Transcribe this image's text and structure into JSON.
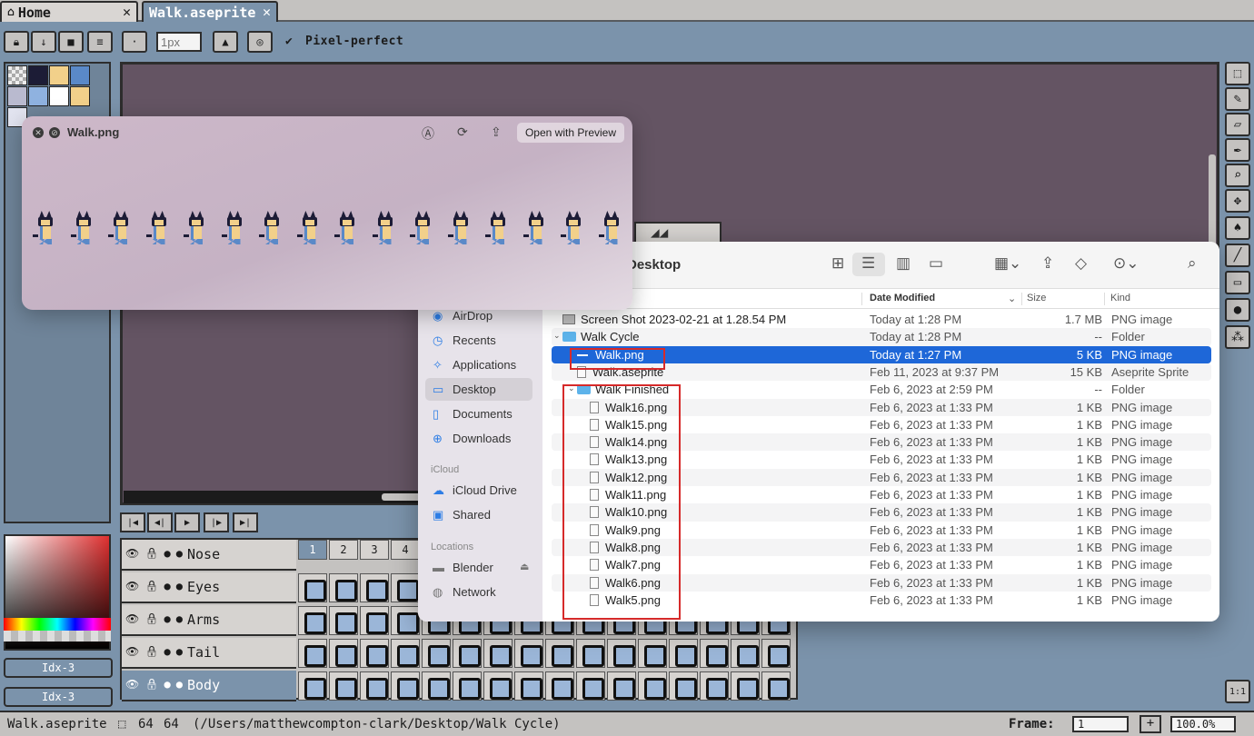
{
  "aseprite": {
    "tabs": [
      {
        "label": "Home",
        "close": "✕"
      },
      {
        "label": "Walk.aseprite",
        "close": "✕"
      }
    ],
    "toolbar": {
      "brush_size_placeholder": "1px",
      "pixel_perfect_label": "Pixel-perfect"
    },
    "layers": [
      {
        "name": "Nose"
      },
      {
        "name": "Eyes"
      },
      {
        "name": "Arms"
      },
      {
        "name": "Tail"
      },
      {
        "name": "Body"
      }
    ],
    "frame_numbers": [
      "1",
      "2",
      "3",
      "4"
    ],
    "idx_buttons": [
      "Idx-3",
      "Idx-3"
    ],
    "status": {
      "filename": "Walk.aseprite",
      "size_w": "64",
      "size_h": "64",
      "path": "(/Users/matthewcompton-clark/Desktop/Walk Cycle)",
      "frame_label": "Frame:",
      "frame_value": "1",
      "plus": "+",
      "zoom": "100.0%"
    }
  },
  "quicklook": {
    "title": "Walk.png",
    "open_button": "Open with Preview"
  },
  "finder": {
    "title": "Desktop",
    "columns": {
      "date": "Date Modified",
      "size": "Size",
      "kind": "Kind"
    },
    "sidebar": {
      "favorites": [
        {
          "label": "AirDrop",
          "icon": "airdrop-icon"
        },
        {
          "label": "Recents",
          "icon": "clock-icon"
        },
        {
          "label": "Applications",
          "icon": "applications-icon"
        },
        {
          "label": "Desktop",
          "icon": "desktop-icon"
        },
        {
          "label": "Documents",
          "icon": "document-icon"
        },
        {
          "label": "Downloads",
          "icon": "download-icon"
        }
      ],
      "icloud_header": "iCloud",
      "icloud": [
        {
          "label": "iCloud Drive",
          "icon": "cloud-icon"
        },
        {
          "label": "Shared",
          "icon": "shared-folder-icon"
        }
      ],
      "locations_header": "Locations",
      "locations": [
        {
          "label": "Blender",
          "icon": "disk-icon"
        },
        {
          "label": "Network",
          "icon": "globe-icon"
        }
      ]
    },
    "rows": [
      {
        "name": "Screen Shot 2023-02-21 at 1.28.54 PM",
        "date": "Today at 1:28 PM",
        "size": "1.7 MB",
        "kind": "PNG image"
      },
      {
        "name": "Walk Cycle",
        "date": "Today at 1:28 PM",
        "size": "--",
        "kind": "Folder"
      },
      {
        "name": "Walk.png",
        "date": "Today at 1:27 PM",
        "size": "5 KB",
        "kind": "PNG image"
      },
      {
        "name": "Walk.aseprite",
        "date": "Feb 11, 2023 at 9:37 PM",
        "size": "15 KB",
        "kind": "Aseprite Sprite"
      },
      {
        "name": "Walk Finished",
        "date": "Feb 6, 2023 at 2:59 PM",
        "size": "--",
        "kind": "Folder"
      },
      {
        "name": "Walk16.png",
        "date": "Feb 6, 2023 at 1:33 PM",
        "size": "1 KB",
        "kind": "PNG image"
      },
      {
        "name": "Walk15.png",
        "date": "Feb 6, 2023 at 1:33 PM",
        "size": "1 KB",
        "kind": "PNG image"
      },
      {
        "name": "Walk14.png",
        "date": "Feb 6, 2023 at 1:33 PM",
        "size": "1 KB",
        "kind": "PNG image"
      },
      {
        "name": "Walk13.png",
        "date": "Feb 6, 2023 at 1:33 PM",
        "size": "1 KB",
        "kind": "PNG image"
      },
      {
        "name": "Walk12.png",
        "date": "Feb 6, 2023 at 1:33 PM",
        "size": "1 KB",
        "kind": "PNG image"
      },
      {
        "name": "Walk11.png",
        "date": "Feb 6, 2023 at 1:33 PM",
        "size": "1 KB",
        "kind": "PNG image"
      },
      {
        "name": "Walk10.png",
        "date": "Feb 6, 2023 at 1:33 PM",
        "size": "1 KB",
        "kind": "PNG image"
      },
      {
        "name": "Walk9.png",
        "date": "Feb 6, 2023 at 1:33 PM",
        "size": "1 KB",
        "kind": "PNG image"
      },
      {
        "name": "Walk8.png",
        "date": "Feb 6, 2023 at 1:33 PM",
        "size": "1 KB",
        "kind": "PNG image"
      },
      {
        "name": "Walk7.png",
        "date": "Feb 6, 2023 at 1:33 PM",
        "size": "1 KB",
        "kind": "PNG image"
      },
      {
        "name": "Walk6.png",
        "date": "Feb 6, 2023 at 1:33 PM",
        "size": "1 KB",
        "kind": "PNG image"
      },
      {
        "name": "Walk5.png",
        "date": "Feb 6, 2023 at 1:33 PM",
        "size": "1 KB",
        "kind": "PNG image"
      }
    ]
  },
  "colors": {
    "selection_blue": "#1e67d8",
    "highlight_red": "#d62a2a",
    "aseprite_blue": "#7b93ab",
    "canvas": "#645463"
  }
}
